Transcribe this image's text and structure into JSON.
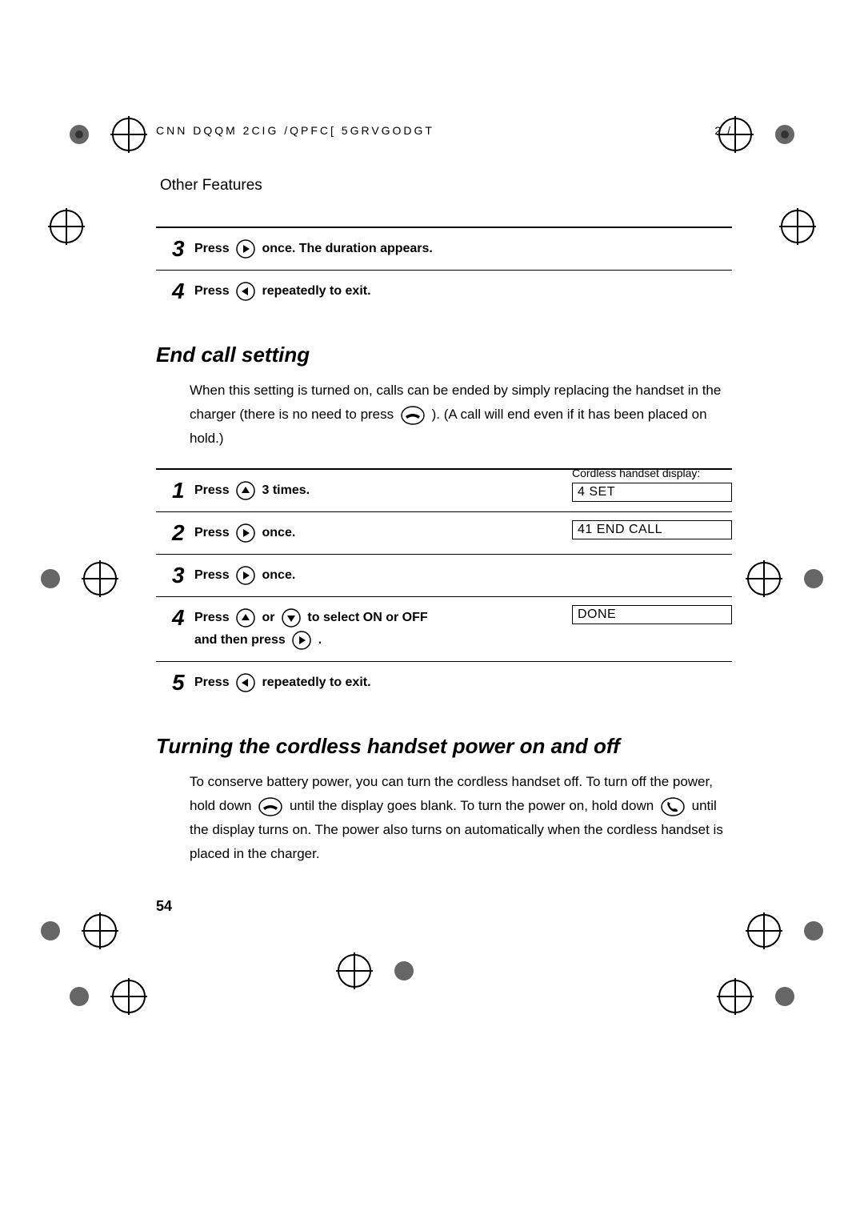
{
  "header": {
    "left": "CNN DQQM  2CIG   /QPFC[  5GRVGODGT",
    "right": "2 /"
  },
  "section_label": "Other Features",
  "top_steps": [
    {
      "num": "3",
      "before": "Press ",
      "icon": "right",
      "after": " once. The duration appears."
    },
    {
      "num": "4",
      "before": "Press ",
      "icon": "left",
      "after": " repeatedly to exit."
    }
  ],
  "endcall": {
    "title": "End call setting",
    "para_before_icon": "When this setting is turned on, calls can be ended by simply replacing the handset in the charger (there is no need to press ",
    "para_after_icon": "). (A call will end even if it has been placed on hold.)",
    "display_label": "Cordless handset display:",
    "displays": {
      "d1": "4  SET",
      "d2": "41 END CALL",
      "d4": "  DONE"
    },
    "steps": {
      "s1": {
        "num": "1",
        "before": "Press ",
        "after": " 3 times."
      },
      "s2": {
        "num": "2",
        "before": "Press ",
        "after": " once."
      },
      "s3": {
        "num": "3",
        "before": "Press ",
        "after": " once."
      },
      "s4": {
        "num": "4",
        "a": "Press ",
        "b": " or ",
        "c": " to select ON or OFF and then press ",
        "d": " ."
      },
      "s5": {
        "num": "5",
        "before": "Press ",
        "after": " repeatedly to exit."
      }
    }
  },
  "power": {
    "title": "Turning the cordless handset power on and off",
    "p1": "To conserve battery power, you can turn the cordless handset off. To turn off the power, hold down ",
    "p2": " until the display goes blank. To turn the power on, hold down ",
    "p3": " until the display turns on. The power also turns on automatically when the cordless handset is placed in the charger."
  },
  "page_number": "54"
}
